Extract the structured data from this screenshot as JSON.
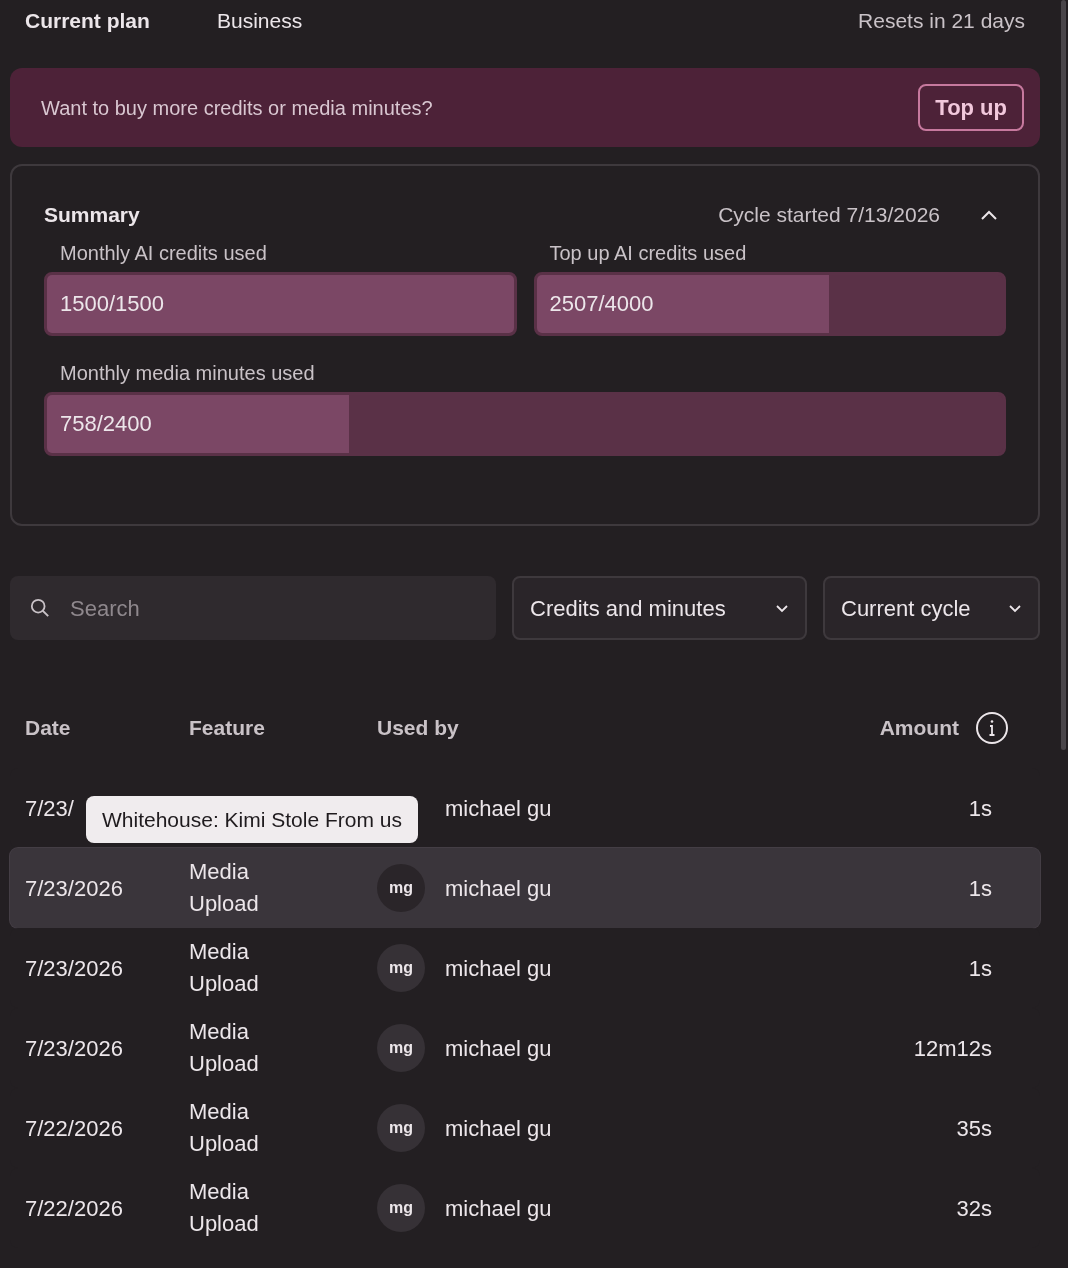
{
  "header": {
    "title": "Current plan",
    "plan": "Business",
    "reset": "Resets in 21 days"
  },
  "banner": {
    "text": "Want to buy more credits or media minutes?",
    "button": "Top up"
  },
  "summary": {
    "title": "Summary",
    "cycle": "Cycle started 7/13/2026",
    "expanded": true,
    "meters": [
      {
        "label": "Monthly AI credits used",
        "reading": "1500/1500",
        "level": 1
      },
      {
        "label": "Top up AI credits used",
        "reading": "2507/4000",
        "level": 0.627
      },
      {
        "label": "Monthly media minutes used",
        "reading": "758/2400",
        "level": 0.316
      }
    ]
  },
  "filters": {
    "search_placeholder": "Search",
    "dropdowns": [
      "Credits and minutes",
      "Current cycle"
    ]
  },
  "table": {
    "columns": [
      "Date",
      "Feature",
      "Used by",
      "Amount"
    ],
    "rows": [
      {
        "date": "7/23/",
        "user": "michael gu",
        "amount": "1s",
        "selected": false,
        "tooltip": "Whitehouse: Kimi Stole From us"
      },
      {
        "date": "7/23/2026",
        "feature": "Media Upload",
        "avatar": "mg",
        "user": "michael gu",
        "amount": "1s",
        "selected": true
      },
      {
        "date": "7/23/2026",
        "feature": "Media Upload",
        "avatar": "mg",
        "user": "michael gu",
        "amount": "1s",
        "selected": false
      },
      {
        "date": "7/23/2026",
        "feature": "Media Upload",
        "avatar": "mg",
        "user": "michael gu",
        "amount": "12m12s",
        "selected": false
      },
      {
        "date": "7/22/2026",
        "feature": "Media Upload",
        "avatar": "mg",
        "user": "michael gu",
        "amount": "35s",
        "selected": false
      },
      {
        "date": "7/22/2026",
        "feature": "Media Upload",
        "avatar": "mg",
        "user": "michael gu",
        "amount": "32s",
        "selected": false
      }
    ]
  }
}
